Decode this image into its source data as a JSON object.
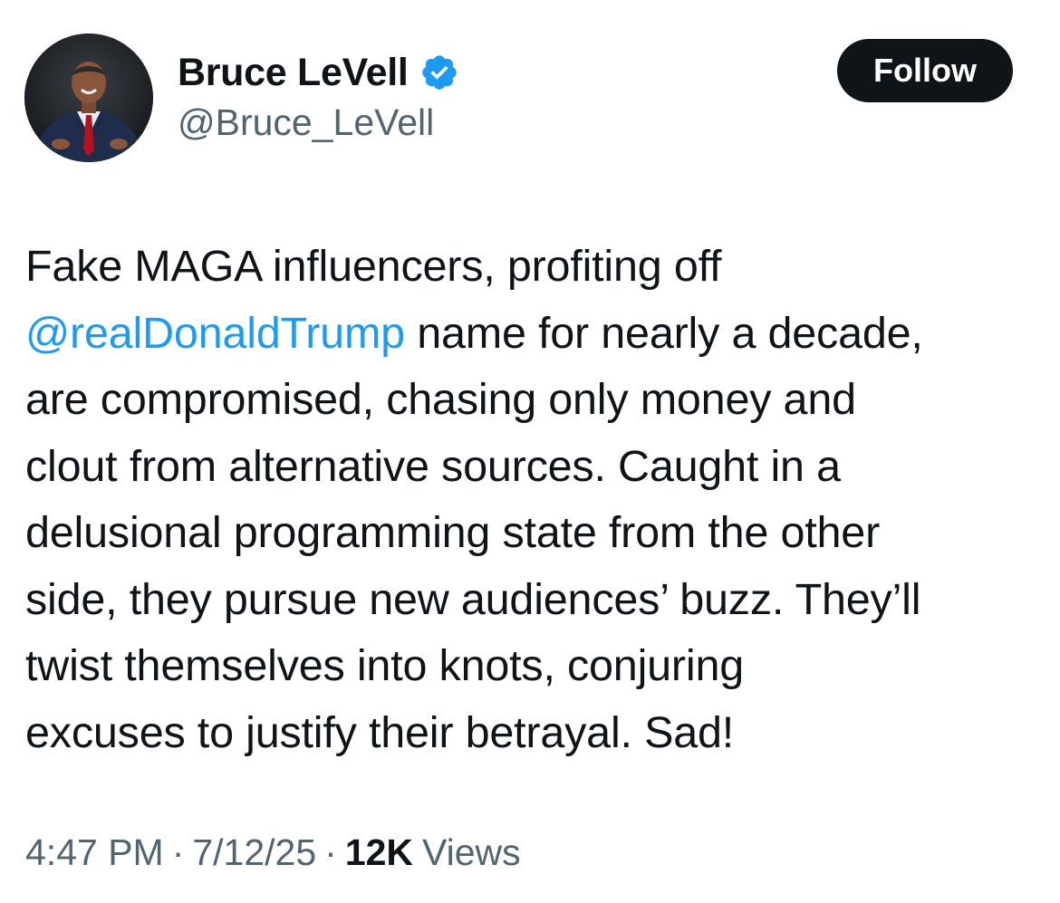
{
  "author": {
    "display_name": "Bruce LeVell",
    "handle": "@Bruce_LeVell",
    "verified_icon": "verified-badge-icon",
    "verified_color": "#1d9bf0"
  },
  "follow_button": {
    "label": "Follow",
    "background": "#0f1419"
  },
  "tweet": {
    "lines": [
      {
        "segments": [
          {
            "text": "Fake MAGA influencers, profiting off",
            "type": "text"
          }
        ]
      },
      {
        "segments": [
          {
            "text": "@realDonaldTrump",
            "type": "mention"
          },
          {
            "text": " name for nearly a decade,",
            "type": "text"
          }
        ]
      },
      {
        "segments": [
          {
            "text": "are compromised, chasing only money and",
            "type": "text"
          }
        ]
      },
      {
        "segments": [
          {
            "text": "clout from alternative sources. Caught in a",
            "type": "text"
          }
        ]
      },
      {
        "segments": [
          {
            "text": "delusional programming state from the other",
            "type": "text"
          }
        ]
      },
      {
        "segments": [
          {
            "text": "side, they pursue new audiences’ buzz. They’ll",
            "type": "text"
          }
        ]
      },
      {
        "segments": [
          {
            "text": "twist themselves into knots, conjuring",
            "type": "text"
          }
        ]
      },
      {
        "segments": [
          {
            "text": "excuses to justify their betrayal. Sad!",
            "type": "text"
          }
        ]
      }
    ],
    "mention_color": "#1d9bf0"
  },
  "meta": {
    "time": "4:47 PM",
    "separator": "·",
    "date": "7/12/25",
    "views_count": "12K",
    "views_label": "Views"
  }
}
